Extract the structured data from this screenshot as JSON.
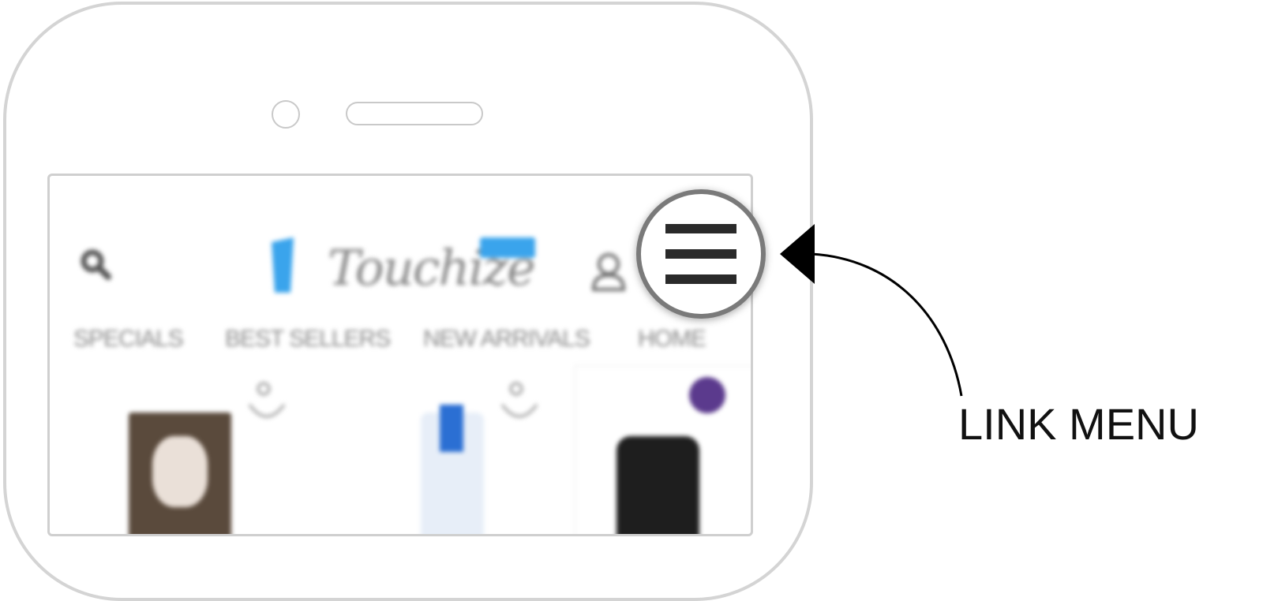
{
  "app": {
    "brand": "Touchize",
    "brand_badge_color": "#3aa4ec",
    "brand_icon": "cart-logo-icon"
  },
  "header_icons": {
    "search": "search-icon",
    "account": "user-icon",
    "menu": "hamburger-menu-icon"
  },
  "nav": {
    "items": [
      "SPECIALS",
      "BEST SELLERS",
      "NEW ARRIVALS",
      "HOME"
    ]
  },
  "products": [
    {
      "icon": "add-to-cart-icon"
    },
    {
      "icon": "add-to-cart-icon"
    },
    {
      "icon": "product-count-badge"
    }
  ],
  "callout": {
    "label": "LINK MENU"
  },
  "colors": {
    "phone_frame": "#d4d4d4",
    "menu_ring": "#7a7a7a",
    "badge_purple": "#5b3a8d"
  }
}
